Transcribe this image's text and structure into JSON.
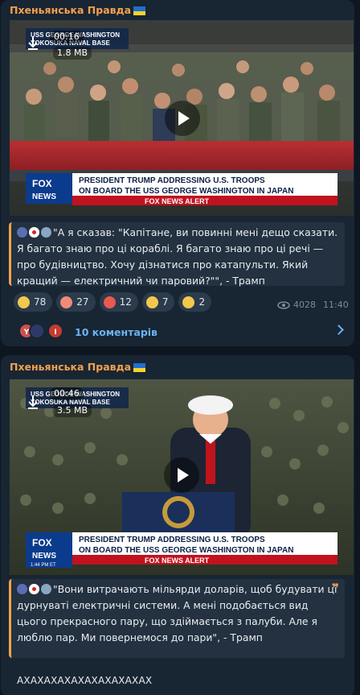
{
  "channel": {
    "name": "Пхеньянська Правда",
    "flag": "ukraine-flag"
  },
  "posts": [
    {
      "video": {
        "duration": "00:16",
        "size": "1.8 MB",
        "banner_tag": "USS GEORGE WASHINGTON\nYOKOSUKA NAVAL BASE",
        "headline": "PRESIDENT TRUMP ADDRESSING U.S. TROOPS ON BOARD THE USS GEORGE WASHINGTON IN JAPAN",
        "network": "FOX NEWS",
        "alert": "FOX NEWS ALERT"
      },
      "caption": "\"А я сказав: \"Капітане, ви повинні мені дещо сказати. Я багато знаю про ці кораблі. Я багато знаю про ці речі — про будівництво. Хочу дізнатися про катапульти. Який кращий — електричний чи паровий?\"\", - Трамп",
      "reactions": [
        {
          "icon": "grinning-face-icon",
          "count": "78",
          "color": "#f2c94c"
        },
        {
          "icon": "clown-face-icon",
          "count": "27",
          "color": "#f08b7a"
        },
        {
          "icon": "clinking-icon",
          "count": "12",
          "color": "#e85a4f"
        },
        {
          "icon": "rofl-face-icon",
          "count": "7",
          "color": "#f2c94c"
        },
        {
          "icon": "thumbs-up-icon",
          "count": "2",
          "color": "#f2c94c"
        }
      ],
      "views": "4028",
      "time": "11:40",
      "comments": {
        "label": "10 коментарів",
        "avatars": [
          {
            "letter": "Y",
            "color": "#d04f4f"
          },
          {
            "letter": "",
            "color": "#2d3a6a"
          },
          {
            "letter": "I",
            "color": "#c63b2f"
          }
        ]
      }
    },
    {
      "video": {
        "duration": "00:46",
        "size": "3.5 MB",
        "banner_tag": "USS GEORGE WASHINGTON\nYOKOSUKA NAVAL BASE",
        "headline": "PRESIDENT TRUMP ADDRESSING U.S. TROOPS ON BOARD THE USS GEORGE WASHINGTON IN JAPAN",
        "network": "FOX NEWS",
        "alert": "FOX NEWS ALERT",
        "time_tag": "1:44 PM ET"
      },
      "caption": "\"Вони витрачають мільярди доларів, щоб будувати ці дурнуваті електричні системи. А мені подобається вид цього прекрасного пару, що здіймається з палуби. Але я люблю пар. Ми повернемося до пари\", - Трамп"
    }
  ],
  "trailing_text": "АХАХАХАХАХАХАХАХАХАХ"
}
